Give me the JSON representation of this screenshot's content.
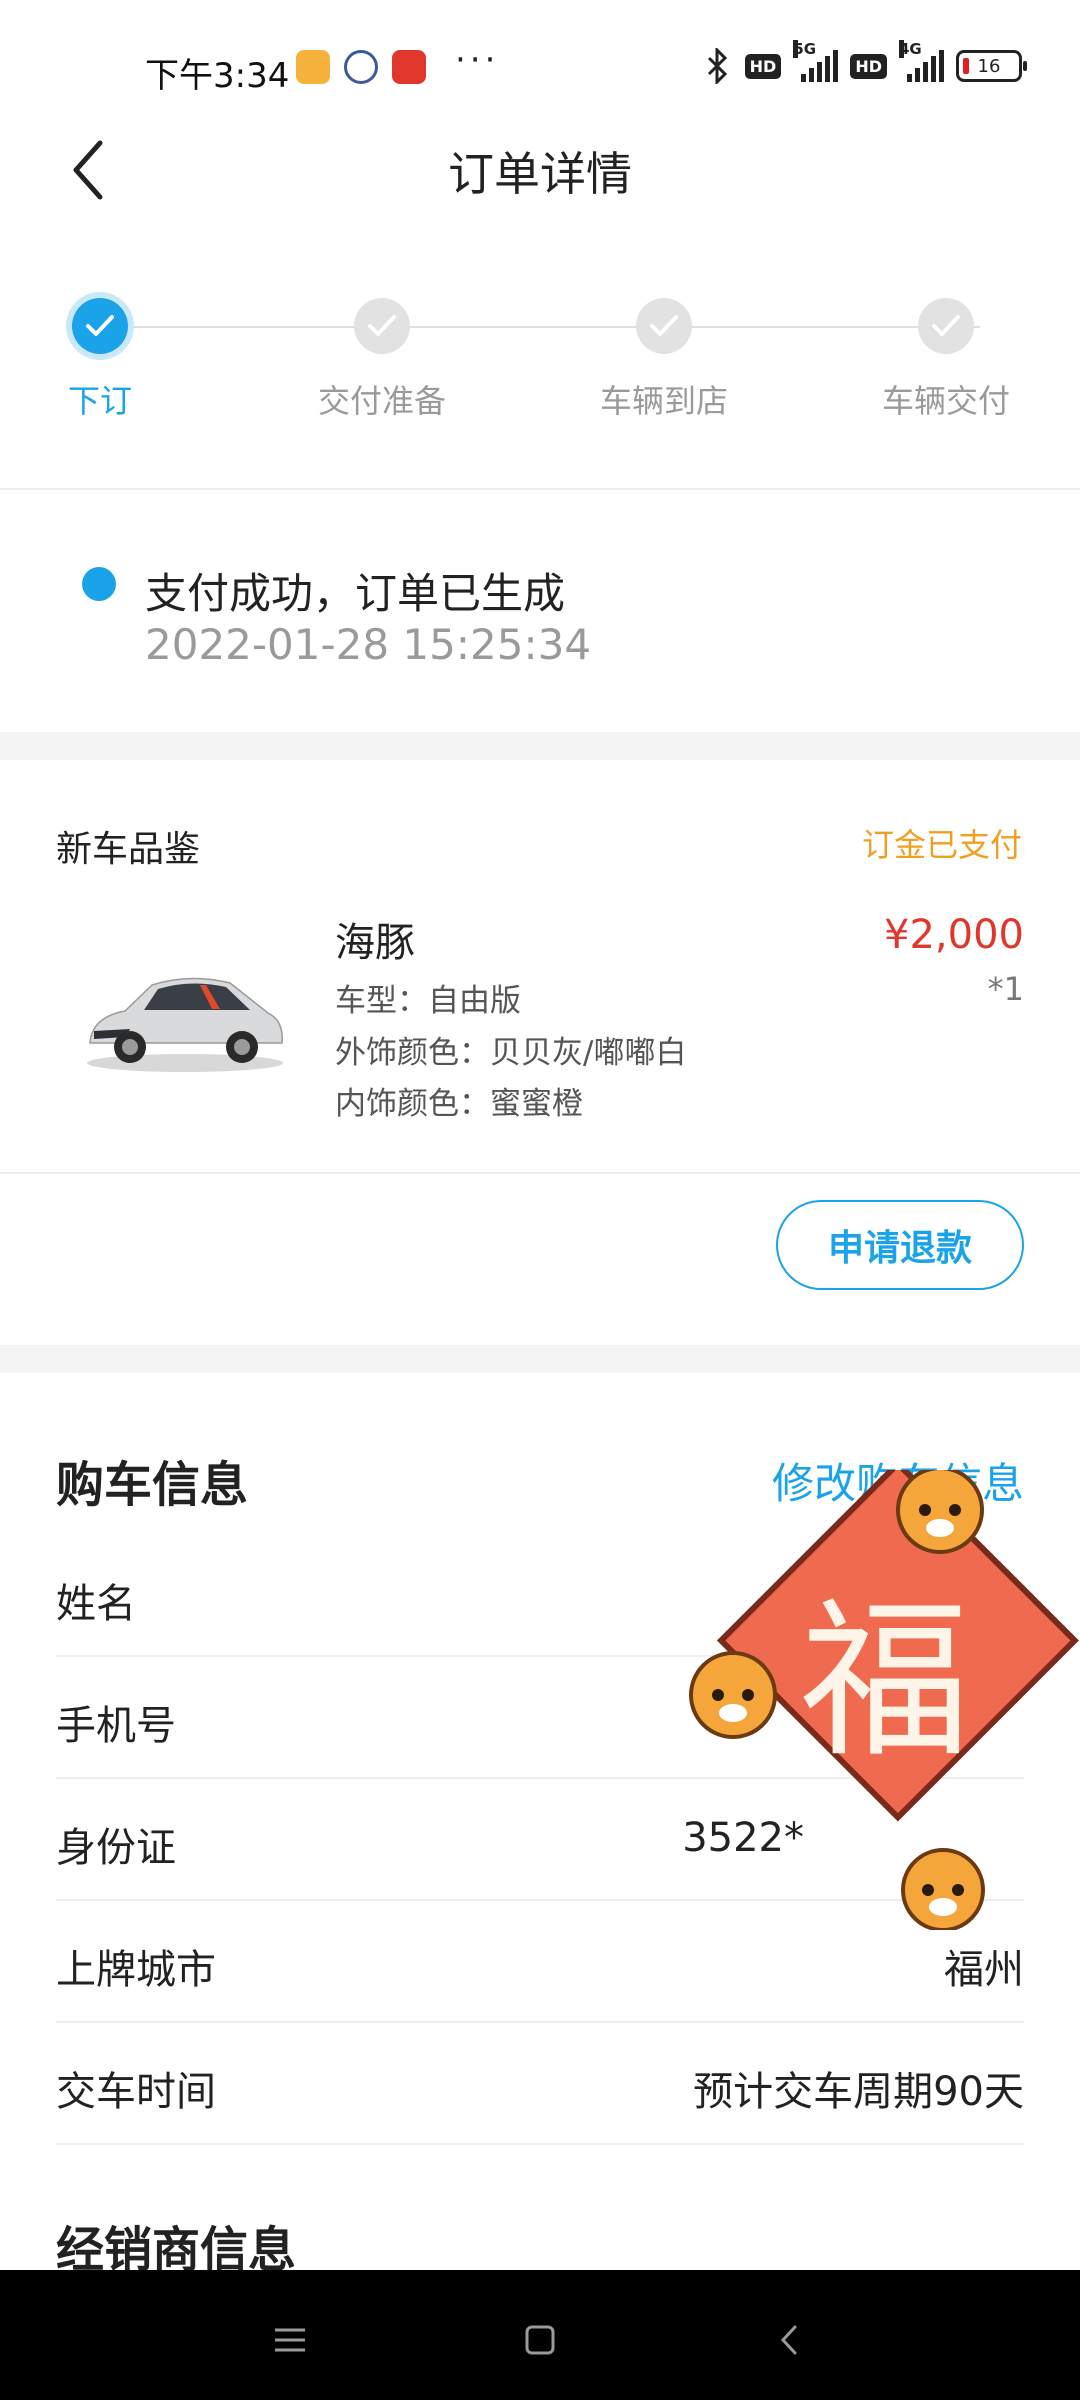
{
  "status_bar": {
    "time": "下午3:34",
    "network_1": "5G",
    "network_2": "4G",
    "hd_label": "HD",
    "battery": "16"
  },
  "header": {
    "title": "订单详情"
  },
  "stepper": {
    "steps": [
      {
        "label": "下订",
        "active": true
      },
      {
        "label": "交付准备",
        "active": false
      },
      {
        "label": "车辆到店",
        "active": false
      },
      {
        "label": "车辆交付",
        "active": false
      }
    ]
  },
  "order_status": {
    "message": "支付成功，订单已生成",
    "timestamp": "2022-01-28 15:25:34"
  },
  "product": {
    "section_title": "新车品鉴",
    "payment_status": "订金已支付",
    "name": "海豚",
    "price": "¥2,000",
    "quantity": "*1",
    "model": "车型：自由版",
    "exterior": "外饰颜色：贝贝灰/嘟嘟白",
    "interior": "内饰颜色：蜜蜜橙",
    "refund_label": "申请退款"
  },
  "buyer": {
    "title": "购车信息",
    "edit_label": "修改购车信息",
    "rows": [
      {
        "label": "姓名",
        "value": ""
      },
      {
        "label": "手机号",
        "value": ""
      },
      {
        "label": "身份证",
        "value": "3522*"
      },
      {
        "label": "上牌城市",
        "value": "福州"
      },
      {
        "label": "交车时间",
        "value": "预计交车周期90天"
      }
    ]
  },
  "dealer": {
    "title": "经销商信息"
  },
  "fu_badge": {
    "character": "福"
  },
  "colors": {
    "accent": "#1aa3e8",
    "price": "#e0362c",
    "paid": "#f0a020",
    "fu_red": "#f06a4f"
  }
}
